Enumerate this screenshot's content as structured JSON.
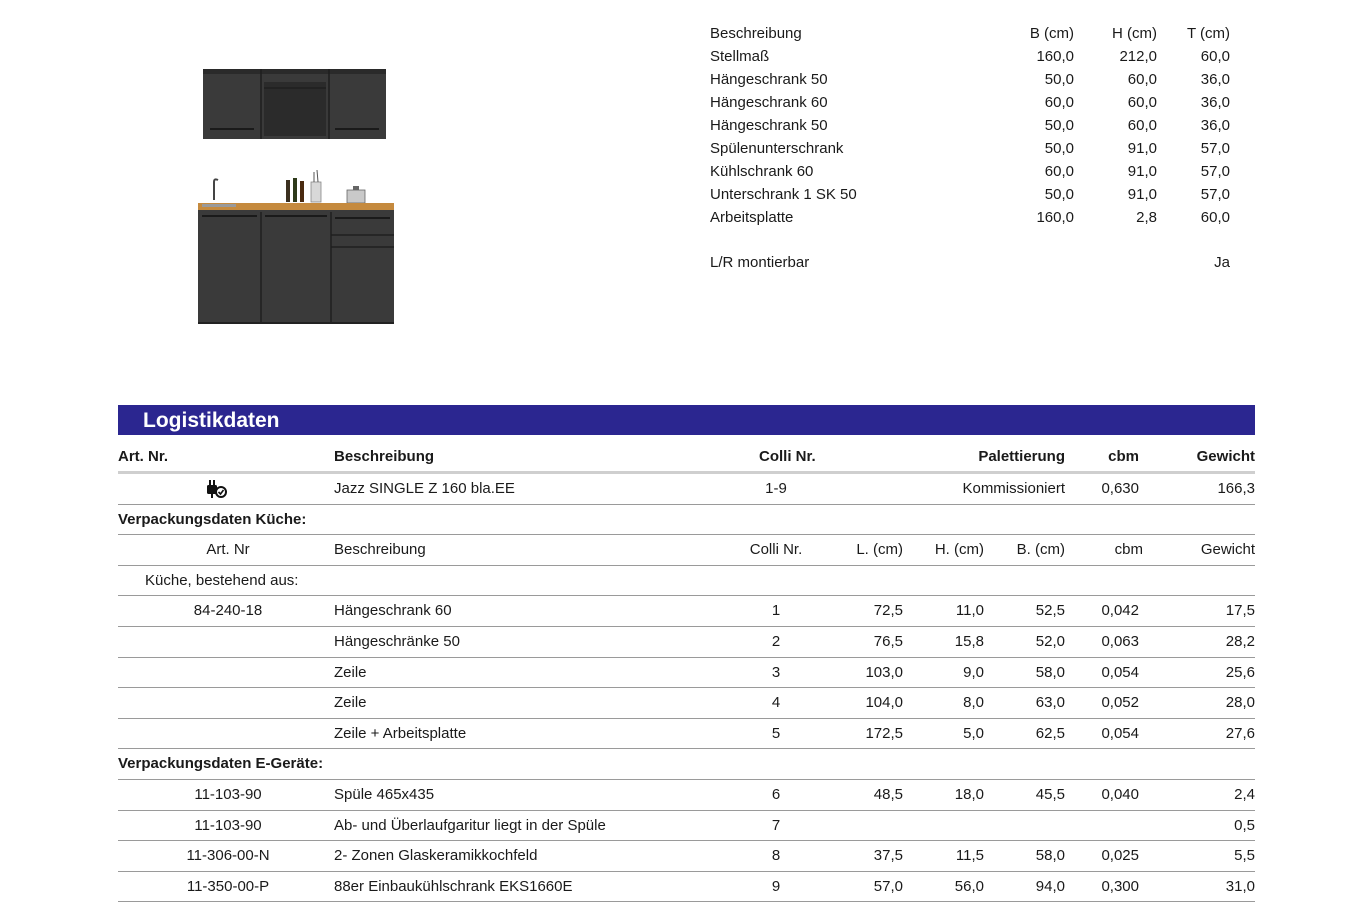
{
  "dimensions": {
    "header": {
      "label": "Beschreibung",
      "b": "B (cm)",
      "h": "H (cm)",
      "t": "T (cm)"
    },
    "rows": [
      {
        "label": "Stellmaß",
        "b": "160,0",
        "h": "212,0",
        "t": "60,0"
      },
      {
        "label": "Hängeschrank 50",
        "b": "50,0",
        "h": "60,0",
        "t": "36,0"
      },
      {
        "label": "Hängeschrank 60",
        "b": "60,0",
        "h": "60,0",
        "t": "36,0"
      },
      {
        "label": "Hängeschrank 50",
        "b": "50,0",
        "h": "60,0",
        "t": "36,0"
      },
      {
        "label": "Spülenunterschrank",
        "b": "50,0",
        "h": "91,0",
        "t": "57,0"
      },
      {
        "label": "Kühlschrank 60",
        "b": "60,0",
        "h": "91,0",
        "t": "57,0"
      },
      {
        "label": "Unterschrank 1 SK 50",
        "b": "50,0",
        "h": "91,0",
        "t": "57,0"
      },
      {
        "label": "Arbeitsplatte",
        "b": "160,0",
        "h": "2,8",
        "t": "60,0"
      }
    ],
    "mount": {
      "label": "L/R montierbar",
      "value": "Ja"
    }
  },
  "logistics": {
    "title": "Logistikdaten",
    "header": {
      "art": "Art. Nr.",
      "desc": "Beschreibung",
      "colli": "Colli Nr.",
      "pal": "Palettierung",
      "cbm": "cbm",
      "gew": "Gewicht"
    },
    "product": {
      "icon": "plug-icon",
      "desc": "Jazz SINGLE Z 160 bla.EE",
      "colli": "1-9",
      "pal": "Kommissioniert",
      "cbm": "0,630",
      "gew": "166,3"
    },
    "kitchen_section": "Verpackungsdaten Küche:",
    "sub_header": {
      "art": "Art. Nr",
      "desc": "Beschreibung",
      "colli": "Colli Nr.",
      "l": "L. (cm)",
      "h": "H. (cm)",
      "b": "B. (cm)",
      "cbm": "cbm",
      "gew": "Gewicht"
    },
    "kitchen_note": "Küche, bestehend aus:",
    "kitchen_items": [
      {
        "art": "84-240-18",
        "desc": "Hängeschrank 60",
        "colli": "1",
        "l": "72,5",
        "h": "11,0",
        "b": "52,5",
        "cbm": "0,042",
        "gew": "17,5"
      },
      {
        "art": "",
        "desc": "Hängeschränke 50",
        "colli": "2",
        "l": "76,5",
        "h": "15,8",
        "b": "52,0",
        "cbm": "0,063",
        "gew": "28,2"
      },
      {
        "art": "",
        "desc": "Zeile",
        "colli": "3",
        "l": "103,0",
        "h": "9,0",
        "b": "58,0",
        "cbm": "0,054",
        "gew": "25,6"
      },
      {
        "art": "",
        "desc": "Zeile",
        "colli": "4",
        "l": "104,0",
        "h": "8,0",
        "b": "63,0",
        "cbm": "0,052",
        "gew": "28,0"
      },
      {
        "art": "",
        "desc": "Zeile + Arbeitsplatte",
        "colli": "5",
        "l": "172,5",
        "h": "5,0",
        "b": "62,5",
        "cbm": "0,054",
        "gew": "27,6"
      }
    ],
    "appliance_section": "Verpackungsdaten E-Geräte:",
    "appliance_items": [
      {
        "art": "11-103-90",
        "desc": "Spüle 465x435",
        "colli": "6",
        "l": "48,5",
        "h": "18,0",
        "b": "45,5",
        "cbm": "0,040",
        "gew": "2,4"
      },
      {
        "art": "11-103-90",
        "desc": "Ab- und Überlaufgaritur liegt in der Spüle",
        "colli": "7",
        "l": "",
        "h": "",
        "b": "",
        "cbm": "",
        "gew": "0,5"
      },
      {
        "art": "11-306-00-N",
        "desc": "2- Zonen Glaskeramikkochfeld",
        "colli": "8",
        "l": "37,5",
        "h": "11,5",
        "b": "58,0",
        "cbm": "0,025",
        "gew": "5,5"
      },
      {
        "art": "11-350-00-P",
        "desc": "88er Einbaukühlschrank EKS1660E",
        "colli": "9",
        "l": "57,0",
        "h": "56,0",
        "b": "94,0",
        "cbm": "0,300",
        "gew": "31,0"
      }
    ]
  }
}
